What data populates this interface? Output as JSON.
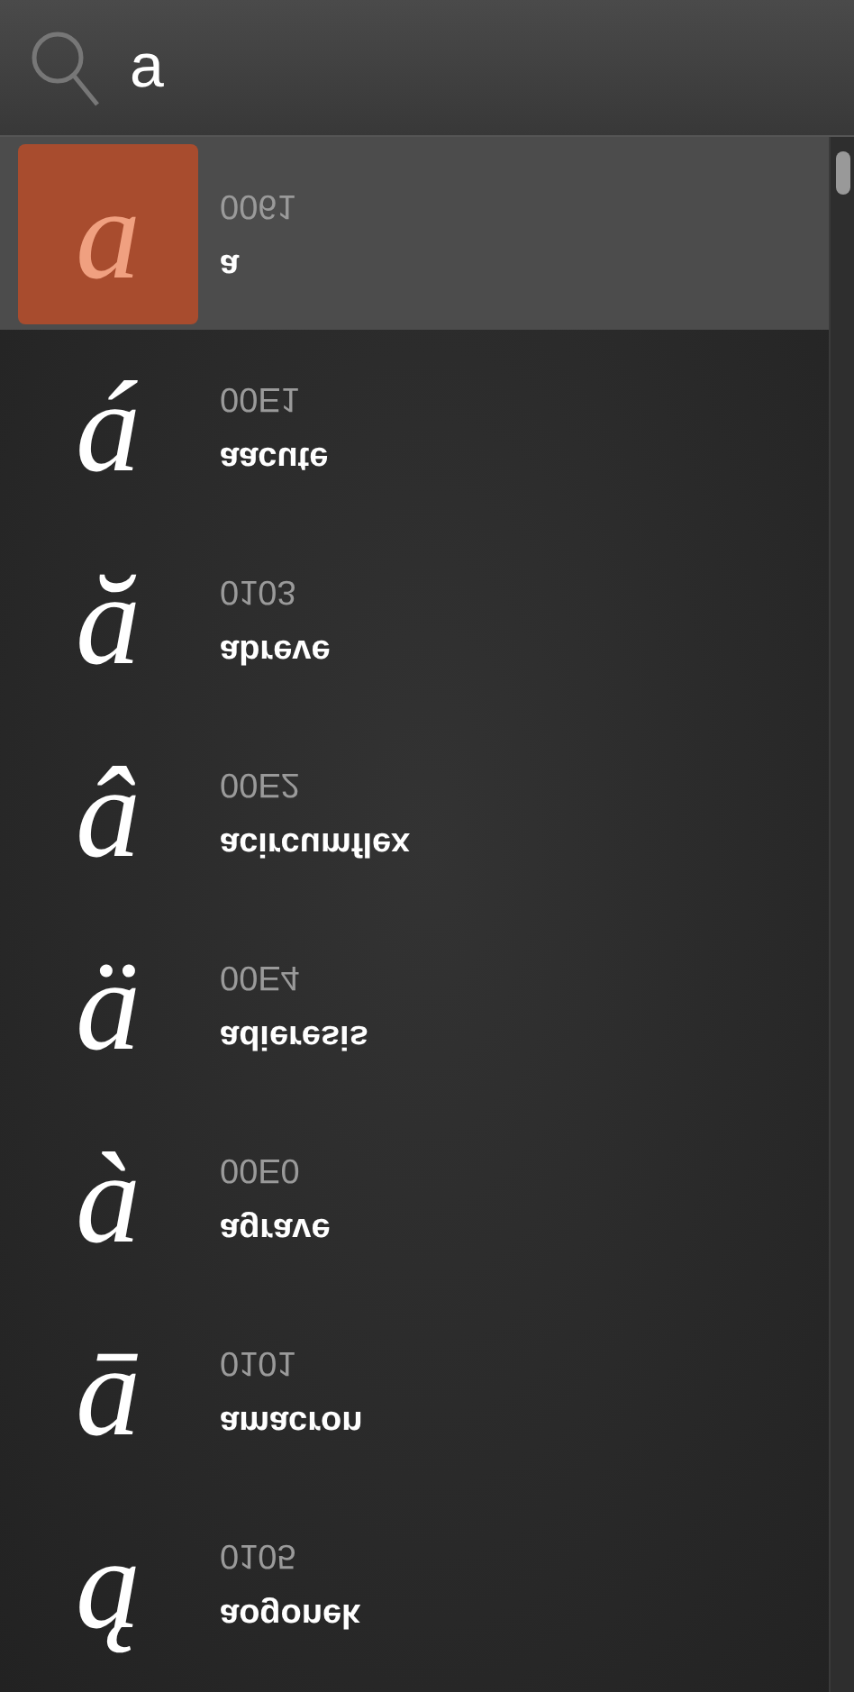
{
  "search": {
    "value": "a"
  },
  "glyphs": [
    {
      "glyph": "a",
      "code": "0061",
      "name": "a",
      "selected": true
    },
    {
      "glyph": "á",
      "code": "00E1",
      "name": "aacute",
      "selected": false
    },
    {
      "glyph": "ă",
      "code": "0103",
      "name": "abreve",
      "selected": false
    },
    {
      "glyph": "â",
      "code": "00E2",
      "name": "acircumflex",
      "selected": false
    },
    {
      "glyph": "ä",
      "code": "00E4",
      "name": "adieresis",
      "selected": false
    },
    {
      "glyph": "à",
      "code": "00E0",
      "name": "agrave",
      "selected": false
    },
    {
      "glyph": "ā",
      "code": "0101",
      "name": "amacron",
      "selected": false
    },
    {
      "glyph": "ą",
      "code": "0105",
      "name": "aogonek",
      "selected": false
    }
  ]
}
